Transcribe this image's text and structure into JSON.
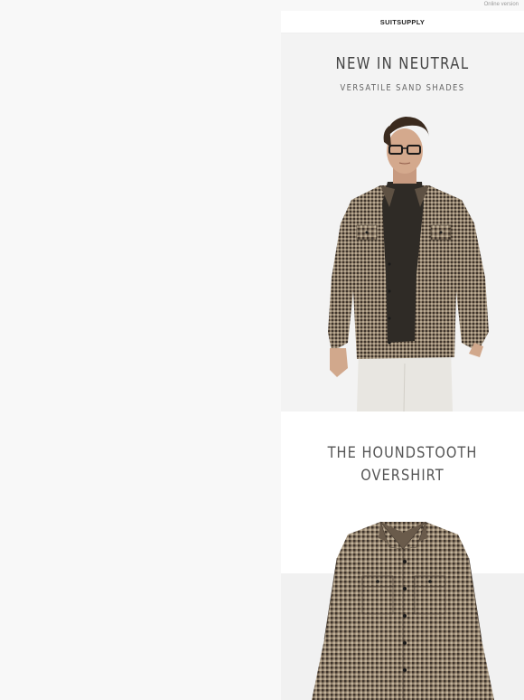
{
  "header": {
    "online_version_label": "Online version"
  },
  "brand": {
    "logo_text": "SUITSUPPLY"
  },
  "hero": {
    "title": "NEW IN NEUTRAL",
    "subtitle": "VERSATILE SAND SHADES",
    "image_alt": "model-wearing-houndstooth-overshirt"
  },
  "product": {
    "title_line1": "THE HOUNDSTOOTH",
    "title_line2": "OVERSHIRT",
    "image_alt": "houndstooth-overshirt-product"
  },
  "colors": {
    "page_bg": "#f8f8f8",
    "email_bg": "#ffffff",
    "hero_bg": "#f3f3f3",
    "text_dark": "#444444"
  }
}
